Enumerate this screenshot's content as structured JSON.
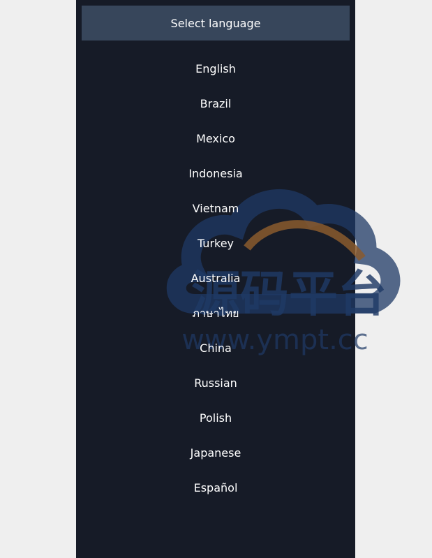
{
  "header": {
    "title": "Select language"
  },
  "languages": [
    {
      "label": "English"
    },
    {
      "label": "Brazil"
    },
    {
      "label": "Mexico"
    },
    {
      "label": "Indonesia"
    },
    {
      "label": "Vietnam"
    },
    {
      "label": "Turkey"
    },
    {
      "label": "Australia"
    },
    {
      "label": "ภาษาไทย"
    },
    {
      "label": "China"
    },
    {
      "label": "Russian"
    },
    {
      "label": "Polish"
    },
    {
      "label": "Japanese"
    },
    {
      "label": "Español"
    }
  ],
  "watermark": {
    "title": "源码平台",
    "url": "www.ympt.cc"
  },
  "colors": {
    "page_bg": "#efefef",
    "panel_bg": "#161b27",
    "header_bg": "#37465b",
    "text": "#ffffff",
    "watermark_blue": "#1f3a66",
    "watermark_orange": "#8a5a2e"
  }
}
